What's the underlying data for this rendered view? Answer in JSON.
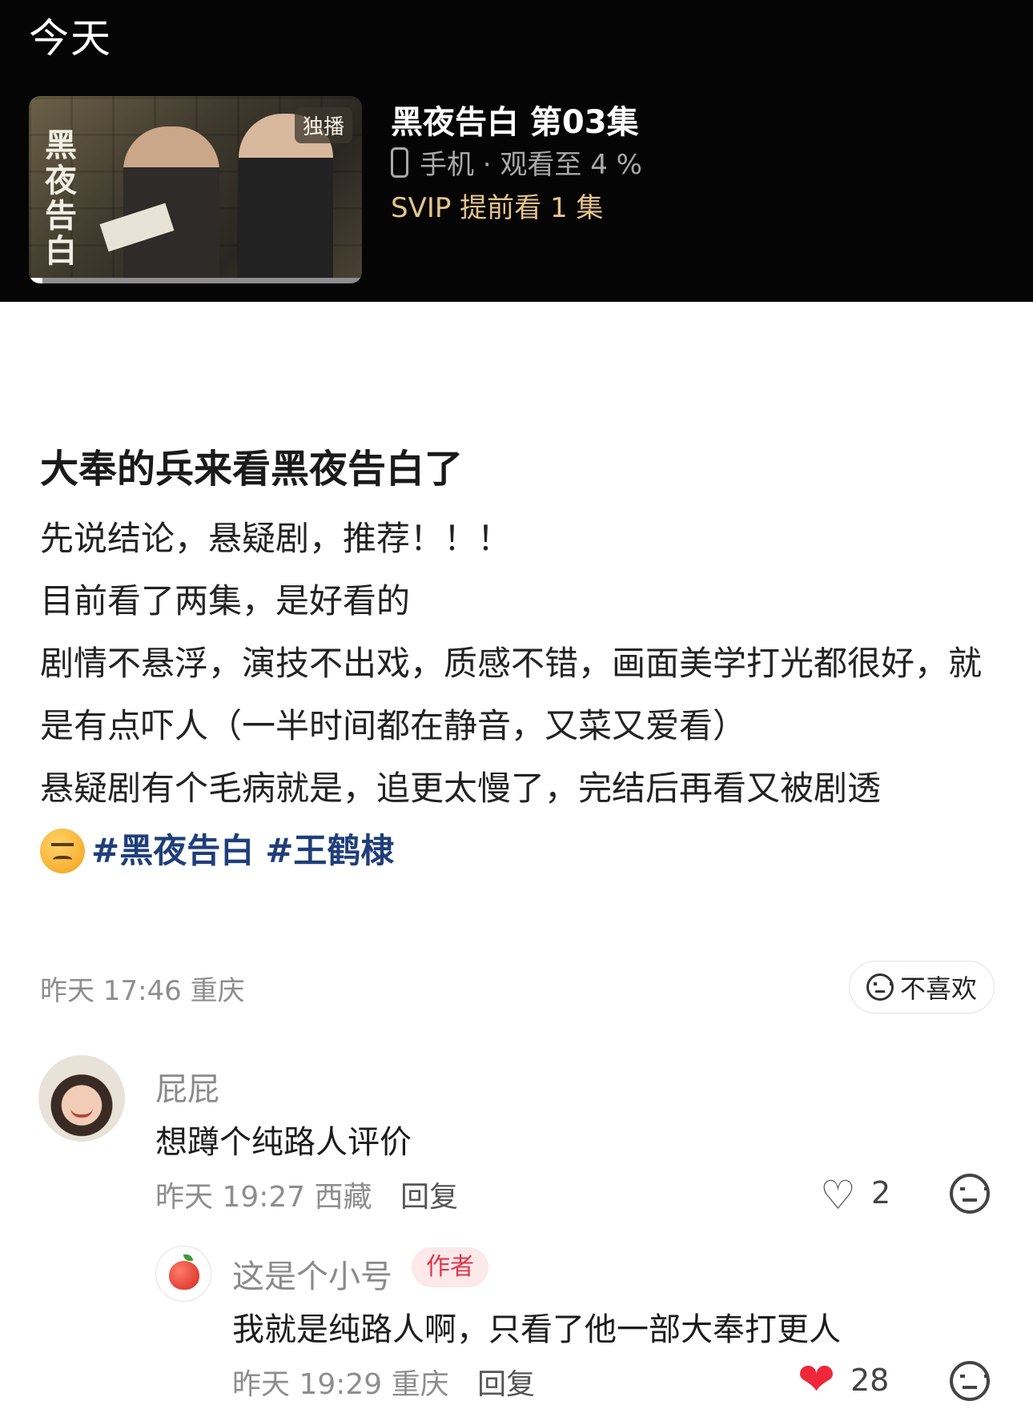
{
  "history": {
    "section_title": "今天",
    "poster_badge": "独播",
    "poster_calligraphy": "黑夜告白",
    "watch_progress_percent": 4,
    "episode_title": "黑夜告白 第03集",
    "device_progress": "手机 · 观看至 4 %",
    "svip_note": "SVIP 提前看 1 集"
  },
  "post": {
    "title": "大奉的兵来看黑夜告白了",
    "lines": [
      "先说结论，悬疑剧，推荐！！！",
      "目前看了两集，是好看的",
      "剧情不悬浮，演技不出戏，质感不错，画面美学打光都很好，就是有点吓人（一半时间都在静音，又菜又爱看）",
      "",
      "悬疑剧有个毛病就是，追更太慢了，完结后再看又被剧透"
    ],
    "hashtags": [
      "#黑夜告白",
      "#王鹤棣"
    ],
    "meta": "昨天 17:46 重庆",
    "dislike_label": "不喜欢"
  },
  "comments": [
    {
      "name": "屁屁",
      "text": "想蹲个纯路人评价",
      "meta": "昨天 19:27 西藏",
      "reply_label": "回复",
      "likes": "2"
    },
    {
      "name": "这是个小号",
      "badge": "作者",
      "text": "我就是纯路人啊，只看了他一部大奉打更人",
      "meta": "昨天 19:29 重庆",
      "reply_label": "回复",
      "likes": "28"
    }
  ],
  "colors": {
    "svip_gold": "#e6c48a",
    "hashtag_blue": "#1f3e7a",
    "like_red": "#f0263a",
    "author_badge_red": "#e0364a"
  },
  "icons": {
    "device": "phone-icon",
    "emoji": "confounded-face-emoji",
    "like_outline": "heart-outline-icon",
    "like_filled": "heart-filled-icon",
    "dislike": "neutral-face-icon"
  }
}
